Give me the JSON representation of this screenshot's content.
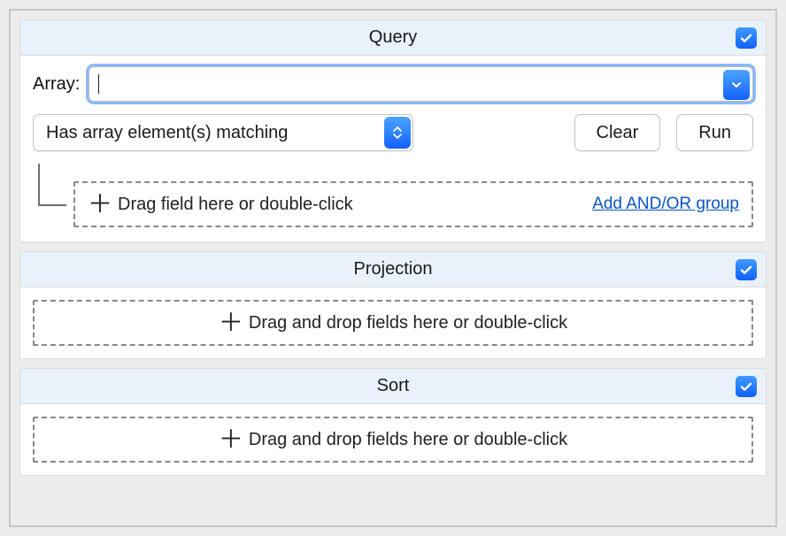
{
  "query": {
    "title": "Query",
    "checked": true,
    "array_label": "Array:",
    "array_value": "",
    "operator": "Has array element(s) matching",
    "clear_label": "Clear",
    "run_label": "Run",
    "dropzone_text": "Drag field here or double-click",
    "add_group_label": "Add AND/OR group"
  },
  "projection": {
    "title": "Projection",
    "checked": true,
    "dropzone_text": "Drag and drop fields here or double-click"
  },
  "sort": {
    "title": "Sort",
    "checked": true,
    "dropzone_text": "Drag and drop fields here or double-click"
  },
  "colors": {
    "accent": "#1f76ff",
    "header_bg": "#e9f1fb"
  }
}
